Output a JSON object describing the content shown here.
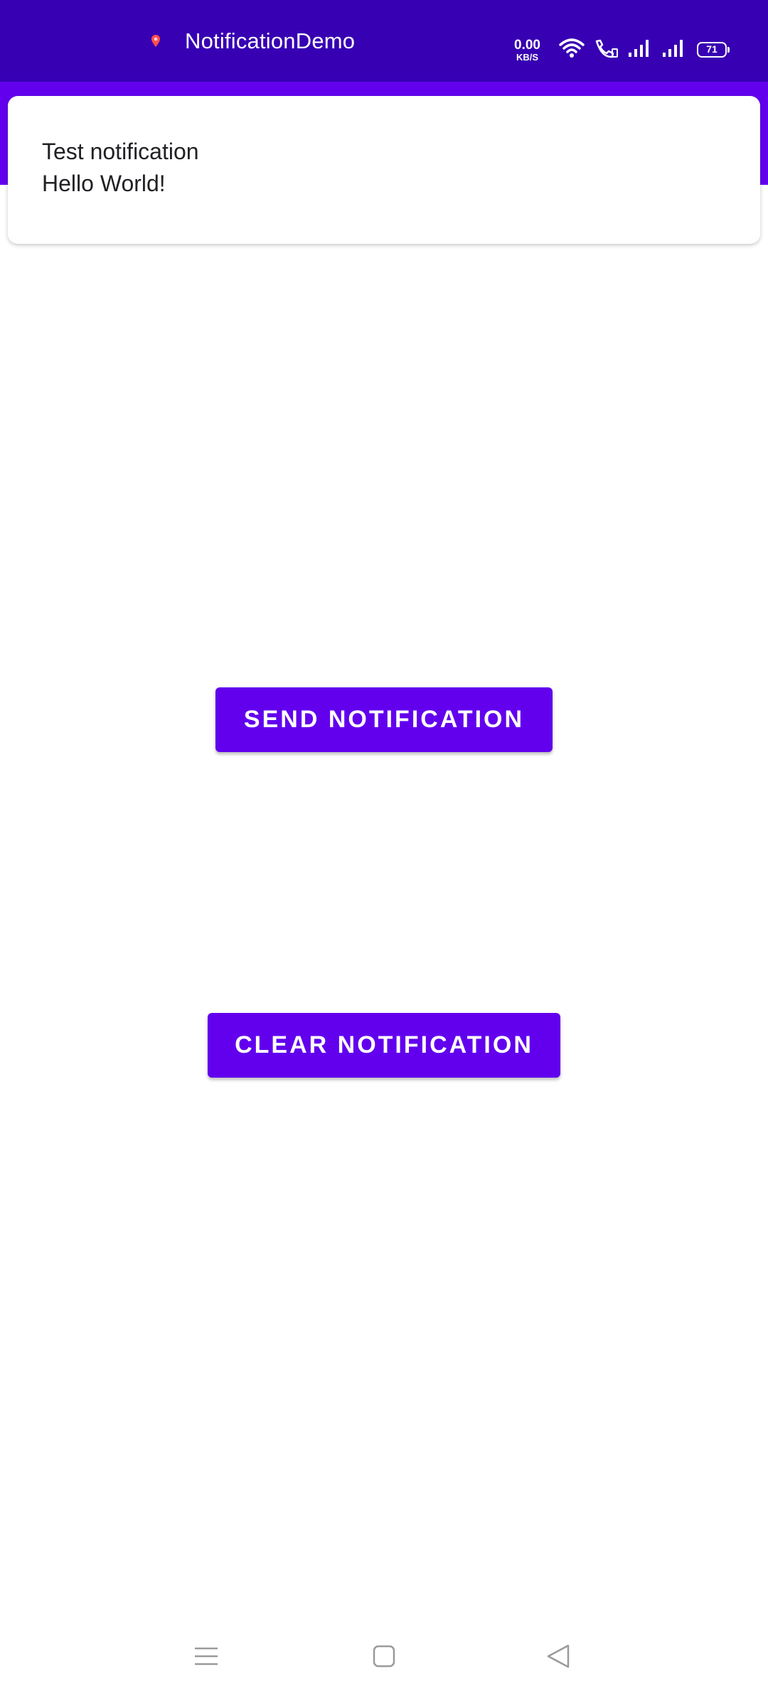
{
  "status_bar": {
    "app_title": "NotificationDemo",
    "network_speed_value": "0.00",
    "network_speed_unit": "KB/S",
    "battery_level": "71",
    "background_color": "#3700b3"
  },
  "app_bar": {
    "background_color": "#6200ee"
  },
  "notification": {
    "title": "Test notification",
    "text": "Hello World!"
  },
  "main": {
    "send_button_label": "SEND NOTIFICATION",
    "clear_button_label": "CLEAR NOTIFICATION",
    "button_color": "#6200ee"
  },
  "nav_bar": {
    "icons": [
      "menu-icon",
      "home-icon",
      "back-icon"
    ]
  }
}
